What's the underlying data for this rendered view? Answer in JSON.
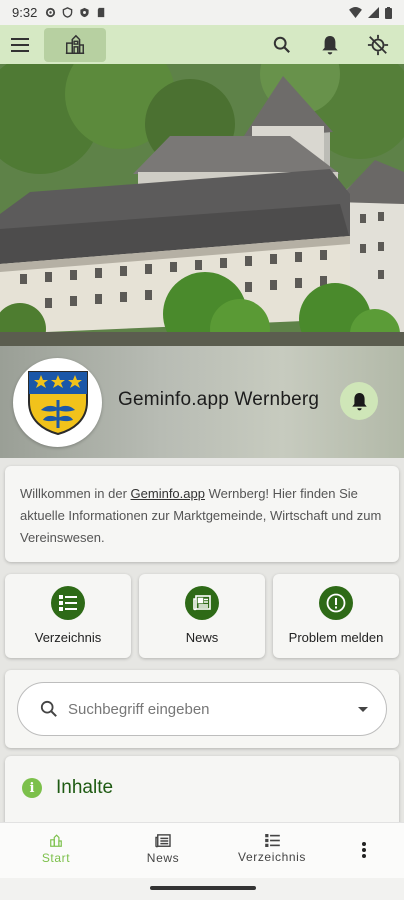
{
  "status_bar": {
    "time": "9:32"
  },
  "app_bar": {
    "menu_icon": "hamburger-menu-icon",
    "home_icon": "town-hall-icon",
    "actions": [
      "search-icon",
      "bell-icon",
      "no-location-icon"
    ]
  },
  "header": {
    "title": "Geminfo.app Wernberg",
    "logo": "coat-of-arms",
    "notify_icon": "bell-icon"
  },
  "intro": {
    "text_before": "Willkommen in der ",
    "link": "Geminfo.app",
    "text_after": " Wernberg! Hier finden Sie aktuelle Informationen zur Marktgemeinde, Wirtschaft und zum Vereinswesen."
  },
  "tiles": [
    {
      "label": "Verzeichnis",
      "icon": "list-icon"
    },
    {
      "label": "News",
      "icon": "newspaper-icon"
    },
    {
      "label": "Problem melden",
      "icon": "alert-icon"
    }
  ],
  "search": {
    "placeholder": "Suchbegriff eingeben"
  },
  "content_section": {
    "title": "Inhalte",
    "icon": "info-icon"
  },
  "bottom_nav": {
    "items": [
      {
        "label": "Start",
        "icon": "town-hall-icon",
        "active": true
      },
      {
        "label": "News",
        "icon": "newspaper-icon",
        "active": false
      },
      {
        "label": "Verzeichnis",
        "icon": "list-icon",
        "active": false
      }
    ],
    "more_icon": "more-vert-icon"
  },
  "colors": {
    "app_bar": "#d6e9c4",
    "accent_green": "#2e6a17",
    "active_nav": "#7cc04b",
    "title_green": "#1e5a12"
  }
}
